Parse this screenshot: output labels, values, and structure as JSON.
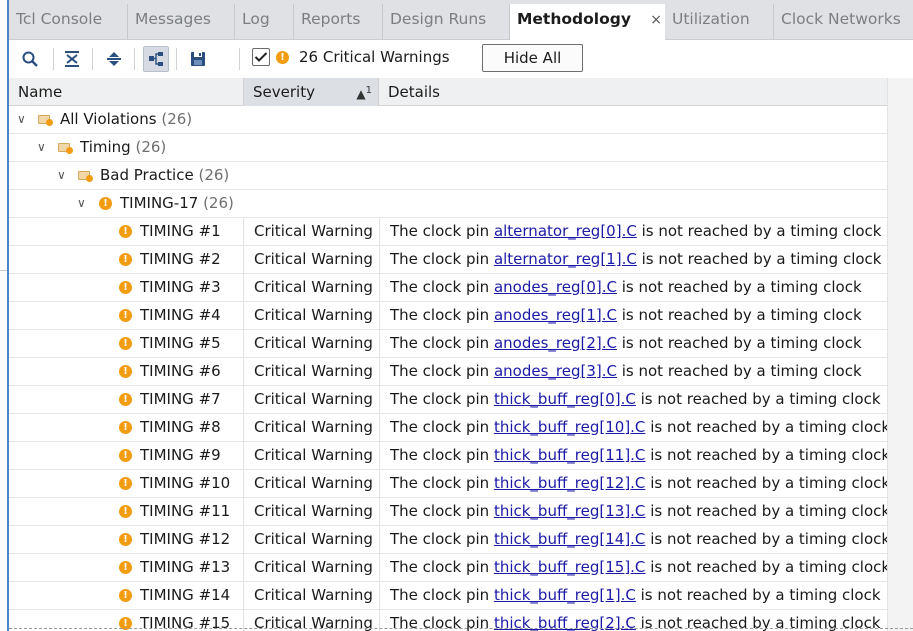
{
  "tabs": [
    {
      "label": "Tcl Console",
      "active": false
    },
    {
      "label": "Messages",
      "active": false
    },
    {
      "label": "Log",
      "active": false
    },
    {
      "label": "Reports",
      "active": false
    },
    {
      "label": "Design Runs",
      "active": false
    },
    {
      "label": "Methodology",
      "active": true
    },
    {
      "label": "Utilization",
      "active": false
    },
    {
      "label": "Clock Networks",
      "active": false
    }
  ],
  "tab_close_glyph": "×",
  "toolbar": {
    "icons": [
      "search-icon",
      "collapse-all-icon",
      "expand-all-icon",
      "group-by-icon",
      "save-icon"
    ],
    "filter_checked": true,
    "filter_label": "26 Critical Warnings",
    "hide_all_label": "Hide All"
  },
  "columns": {
    "name": "Name",
    "severity": "Severity",
    "severity_sort": "1",
    "details": "Details"
  },
  "tree": [
    {
      "label": "All Violations",
      "count": "(26)"
    },
    {
      "label": "Timing",
      "count": "(26)"
    },
    {
      "label": "Bad Practice",
      "count": "(26)"
    },
    {
      "label": "TIMING-17",
      "count": "(26)"
    }
  ],
  "violations": [
    {
      "id": "TIMING #1",
      "severity": "Critical Warning",
      "prefix": "The clock pin ",
      "pin": "alternator_reg[0].C",
      "suffix": " is not reached by a timing clock"
    },
    {
      "id": "TIMING #2",
      "severity": "Critical Warning",
      "prefix": "The clock pin ",
      "pin": "alternator_reg[1].C",
      "suffix": " is not reached by a timing clock"
    },
    {
      "id": "TIMING #3",
      "severity": "Critical Warning",
      "prefix": "The clock pin ",
      "pin": "anodes_reg[0].C",
      "suffix": " is not reached by a timing clock"
    },
    {
      "id": "TIMING #4",
      "severity": "Critical Warning",
      "prefix": "The clock pin ",
      "pin": "anodes_reg[1].C",
      "suffix": " is not reached by a timing clock"
    },
    {
      "id": "TIMING #5",
      "severity": "Critical Warning",
      "prefix": "The clock pin ",
      "pin": "anodes_reg[2].C",
      "suffix": " is not reached by a timing clock"
    },
    {
      "id": "TIMING #6",
      "severity": "Critical Warning",
      "prefix": "The clock pin ",
      "pin": "anodes_reg[3].C",
      "suffix": " is not reached by a timing clock"
    },
    {
      "id": "TIMING #7",
      "severity": "Critical Warning",
      "prefix": "The clock pin ",
      "pin": "thick_buff_reg[0].C",
      "suffix": " is not reached by a timing clock"
    },
    {
      "id": "TIMING #8",
      "severity": "Critical Warning",
      "prefix": "The clock pin ",
      "pin": "thick_buff_reg[10].C",
      "suffix": " is not reached by a timing clock"
    },
    {
      "id": "TIMING #9",
      "severity": "Critical Warning",
      "prefix": "The clock pin ",
      "pin": "thick_buff_reg[11].C",
      "suffix": " is not reached by a timing clock"
    },
    {
      "id": "TIMING #10",
      "severity": "Critical Warning",
      "prefix": "The clock pin ",
      "pin": "thick_buff_reg[12].C",
      "suffix": " is not reached by a timing clock"
    },
    {
      "id": "TIMING #11",
      "severity": "Critical Warning",
      "prefix": "The clock pin ",
      "pin": "thick_buff_reg[13].C",
      "suffix": " is not reached by a timing clock"
    },
    {
      "id": "TIMING #12",
      "severity": "Critical Warning",
      "prefix": "The clock pin ",
      "pin": "thick_buff_reg[14].C",
      "suffix": " is not reached by a timing clock"
    },
    {
      "id": "TIMING #13",
      "severity": "Critical Warning",
      "prefix": "The clock pin ",
      "pin": "thick_buff_reg[15].C",
      "suffix": " is not reached by a timing clock"
    },
    {
      "id": "TIMING #14",
      "severity": "Critical Warning",
      "prefix": "The clock pin ",
      "pin": "thick_buff_reg[1].C",
      "suffix": " is not reached by a timing clock"
    },
    {
      "id": "TIMING #15",
      "severity": "Critical Warning",
      "prefix": "The clock pin ",
      "pin": "thick_buff_reg[2].C",
      "suffix": " is not reached by a timing clock"
    }
  ],
  "colors": {
    "accent": "#4f7fc7",
    "warning": "#f39c12",
    "link": "#1a1aa8"
  }
}
